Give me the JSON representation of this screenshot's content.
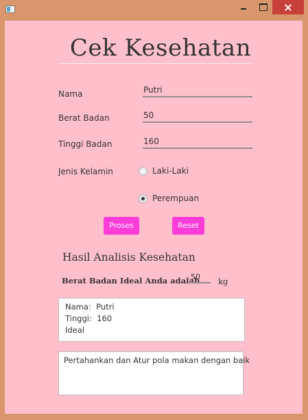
{
  "window": {
    "title": ""
  },
  "form": {
    "title": "Cek Kesehatan",
    "nama_label": "Nama",
    "nama_value": "Putri",
    "berat_label": "Berat Badan",
    "berat_value": "50",
    "tinggi_label": "Tinggi Badan",
    "tinggi_value": "160",
    "kelamin_label": "Jenis Kelamin",
    "options": [
      {
        "label": "Laki-Laki",
        "selected": false
      },
      {
        "label": "Perempuan",
        "selected": true
      }
    ],
    "proses_label": "Proses",
    "reset_label": "Reset"
  },
  "result": {
    "heading": "Hasil Analisis Kesehatan",
    "ideal_label": "Berat Badan Ideal Anda adalah",
    "ideal_value": "50",
    "unit": "kg",
    "summary_lines": [
      "Nama:  Putri",
      "Tinggi:  160",
      "Ideal"
    ],
    "advice": "Pertahankan dan Atur pola makan dengan baik"
  },
  "colors": {
    "background": "#ffc0cb",
    "frame": "#d9956b",
    "button": "#ff3bd8",
    "close_button": "#c7403a"
  }
}
